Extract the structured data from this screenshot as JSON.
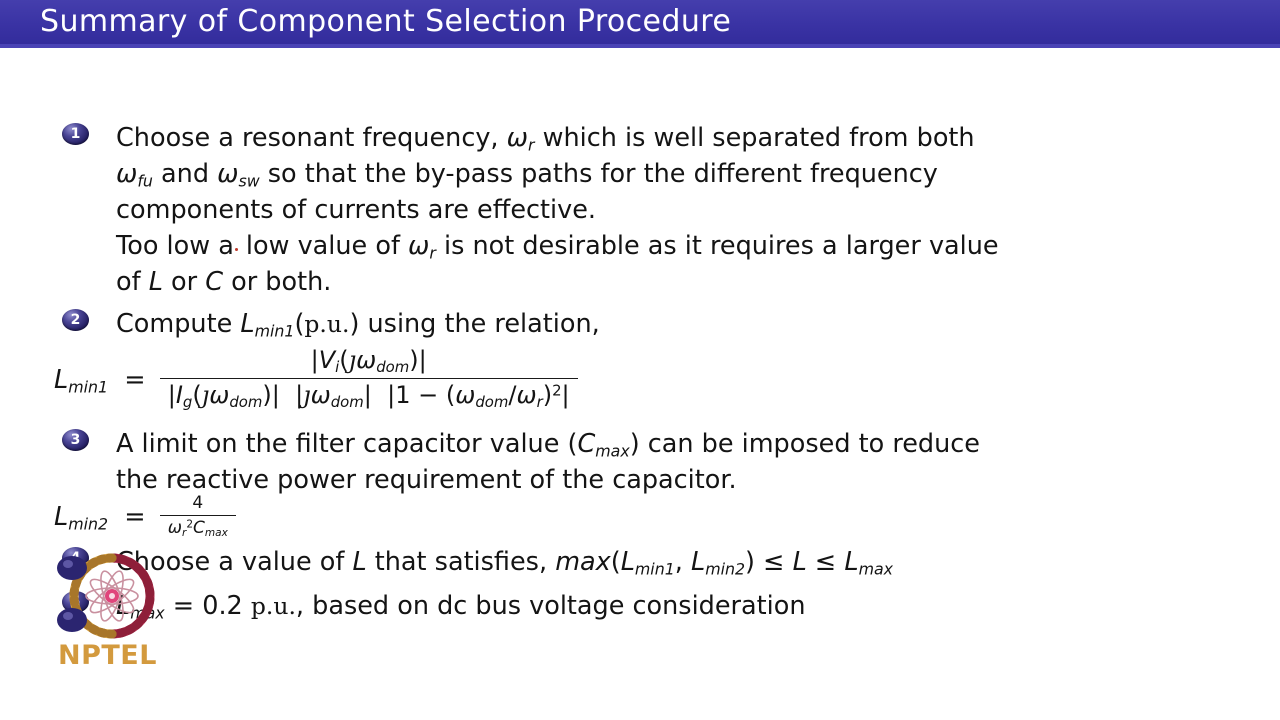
{
  "slide": {
    "title": "Summary of Component Selection Procedure",
    "title_bar_color": "#3b35a8",
    "background_color": "#ffffff",
    "text_color": "#141414"
  },
  "items": [
    {
      "number": "1",
      "lines": [
        "Choose a resonant frequency, ωr which is well separated from both",
        "ωfu and ωsw so that the by-pass paths for the different frequency",
        "components of currents are effective.",
        "Too low a low value of ωr is not desirable as it requires a larger value",
        "of L or C or both."
      ]
    },
    {
      "number": "2",
      "lines": [
        "Compute Lmin1(p.u.) using the relation,"
      ],
      "equation": {
        "lhs": "Lmin1 =",
        "numerator": "|Vi(ȷωdom)|",
        "denominator": "|Ig(ȷωdom)| |ȷωdom| |1 − (ωdom/ωr)2|"
      }
    },
    {
      "number": "3",
      "lines": [
        "A limit on the filter capacitor value (Cmax) can be imposed to reduce",
        "the reactive power requirement of the capacitor."
      ],
      "equation": {
        "lhs": "Lmin2 =",
        "numerator": "4",
        "denominator": "ωr2 Cmax"
      }
    },
    {
      "number": "4",
      "lines": [
        "Choose a value of L that satisfies, max(Lmin1, Lmin2) ≤ L ≤ Lmax"
      ]
    },
    {
      "number": "5",
      "lines": [
        "Lmax = 0.2 p.u., based on dc bus voltage consideration"
      ]
    }
  ],
  "logo": {
    "wordmark": "NPTEL",
    "wordmark_color": "#d39a3e",
    "ring_left_color": "#d9a441",
    "ring_right_color": "#b02a4a",
    "flower_color": "#e0457b"
  }
}
